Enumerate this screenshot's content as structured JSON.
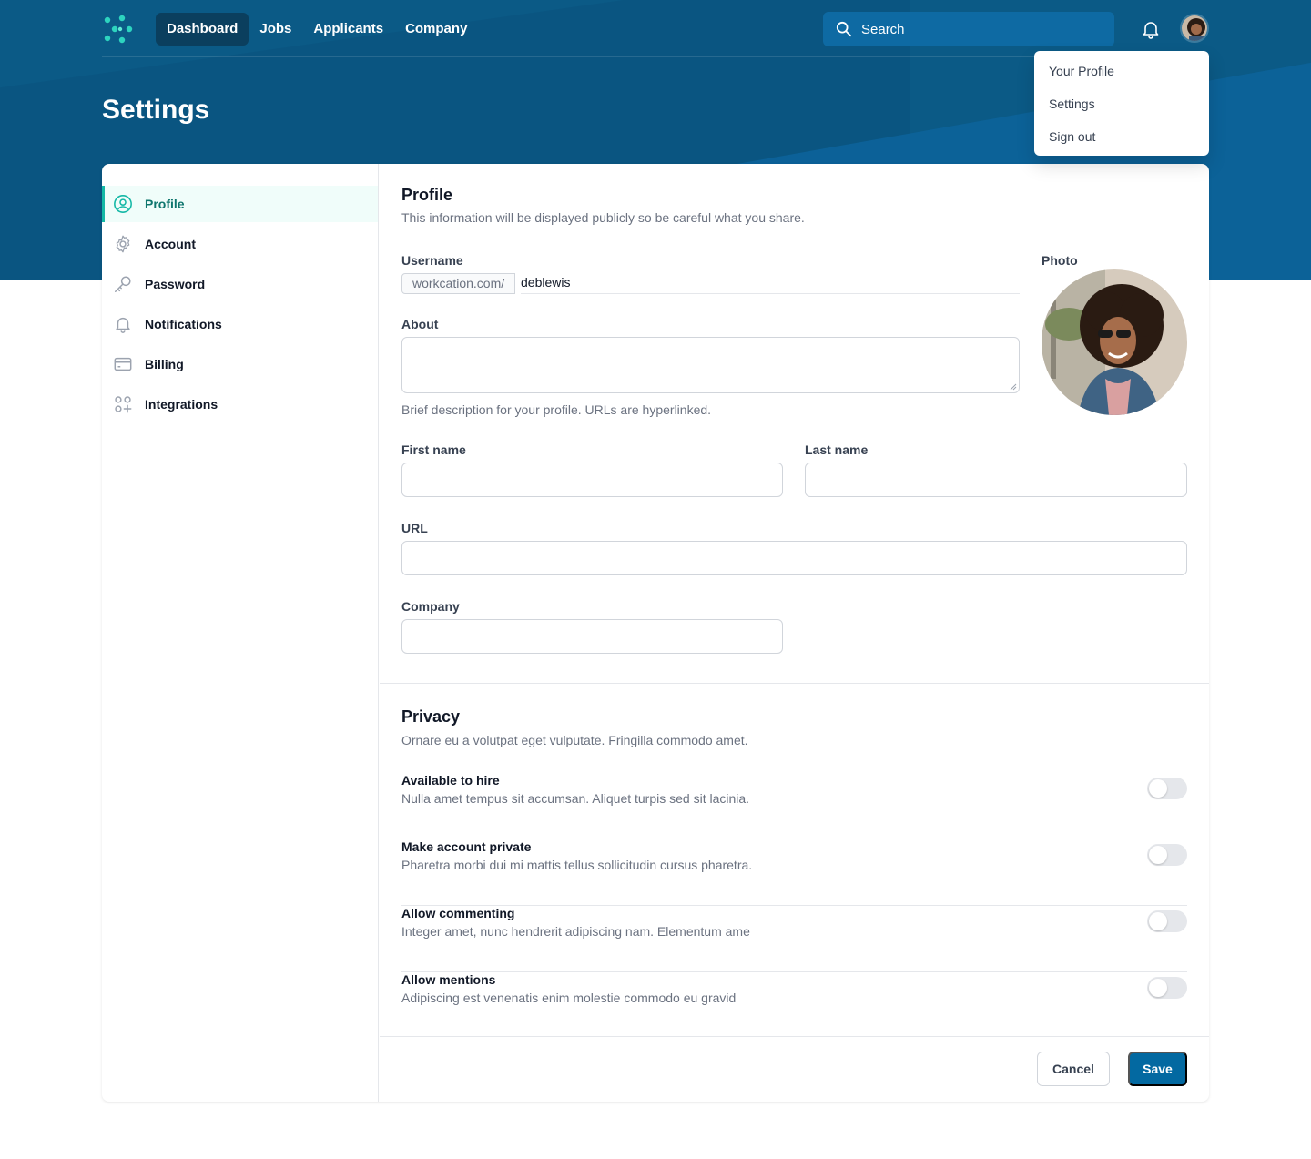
{
  "nav": {
    "links": [
      "Dashboard",
      "Jobs",
      "Applicants",
      "Company"
    ],
    "active": "Dashboard",
    "search_placeholder": "Search"
  },
  "page": {
    "title": "Settings"
  },
  "user_menu": {
    "items": [
      "Your Profile",
      "Settings",
      "Sign out"
    ]
  },
  "sidebar": {
    "items": [
      {
        "label": "Profile",
        "icon": "user-circle-icon",
        "active": true
      },
      {
        "label": "Account",
        "icon": "gear-icon"
      },
      {
        "label": "Password",
        "icon": "key-icon"
      },
      {
        "label": "Notifications",
        "icon": "bell-icon"
      },
      {
        "label": "Billing",
        "icon": "credit-card-icon"
      },
      {
        "label": "Integrations",
        "icon": "squares-plus-icon"
      }
    ]
  },
  "profile": {
    "heading": "Profile",
    "subtitle": "This information will be displayed publicly so be careful what you share.",
    "username_label": "Username",
    "username_prefix": "workcation.com/",
    "username_value": "deblewis",
    "about_label": "About",
    "about_help": "Brief description for your profile. URLs are hyperlinked.",
    "photo_label": "Photo",
    "first_name_label": "First name",
    "last_name_label": "Last name",
    "url_label": "URL",
    "company_label": "Company"
  },
  "privacy": {
    "heading": "Privacy",
    "subtitle": "Ornare eu a volutpat eget vulputate. Fringilla commodo amet.",
    "rows": [
      {
        "title": "Available to hire",
        "desc": "Nulla amet tempus sit accumsan. Aliquet turpis sed sit lacinia.",
        "on": false
      },
      {
        "title": "Make account private",
        "desc": "Pharetra morbi dui mi mattis tellus sollicitudin cursus pharetra.",
        "on": false
      },
      {
        "title": "Allow commenting",
        "desc": "Integer amet, nunc hendrerit adipiscing nam. Elementum ame",
        "on": false
      },
      {
        "title": "Allow mentions",
        "desc": "Adipiscing est venenatis enim molestie commodo eu gravid",
        "on": false
      }
    ]
  },
  "actions": {
    "cancel": "Cancel",
    "save": "Save"
  },
  "colors": {
    "header": "#0b5a86",
    "accent": "#14b8a6",
    "save": "#0369a1"
  }
}
